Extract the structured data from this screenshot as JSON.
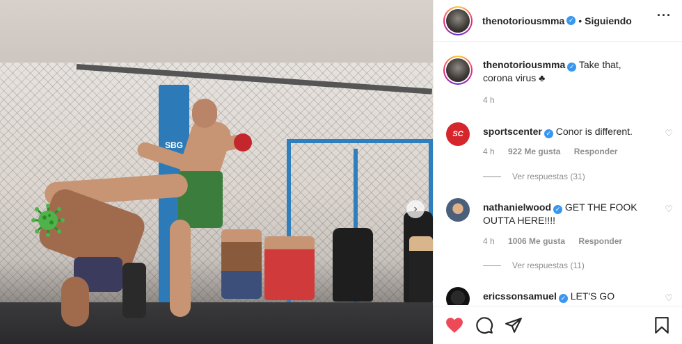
{
  "post": {
    "username": "thenotoriousmma",
    "follow_state": "Siguiendo",
    "dot": "•",
    "more_label": "···"
  },
  "caption": {
    "username": "thenotoriousmma",
    "text": "Take that, corona virus ♣",
    "time": "4 h"
  },
  "comments": [
    {
      "username": "sportscenter",
      "text": "Conor is different.",
      "time": "4 h",
      "likes": "922 Me gusta",
      "reply_label": "Responder",
      "view_replies": "Ver respuestas (31)",
      "avatar_text": "SC"
    },
    {
      "username": "nathanielwood",
      "text": "GET THE FOOK OUTTA HERE!!!!",
      "time": "4 h",
      "likes": "1006 Me gusta",
      "reply_label": "Responder",
      "view_replies": "Ver respuestas (11)"
    },
    {
      "username": "ericssonsamuel",
      "text": "LET'S GO"
    }
  ],
  "photo": {
    "sbg_label": "SBG",
    "next_arrow": "›"
  },
  "icons": {
    "like": "heart-icon",
    "comment": "comment-icon",
    "share": "share-icon",
    "save": "bookmark-icon",
    "verified": "verified-badge-icon"
  },
  "colors": {
    "like_red": "#ed4956",
    "verified_blue": "#3897f0",
    "sportscenter_red": "#d6262c"
  }
}
